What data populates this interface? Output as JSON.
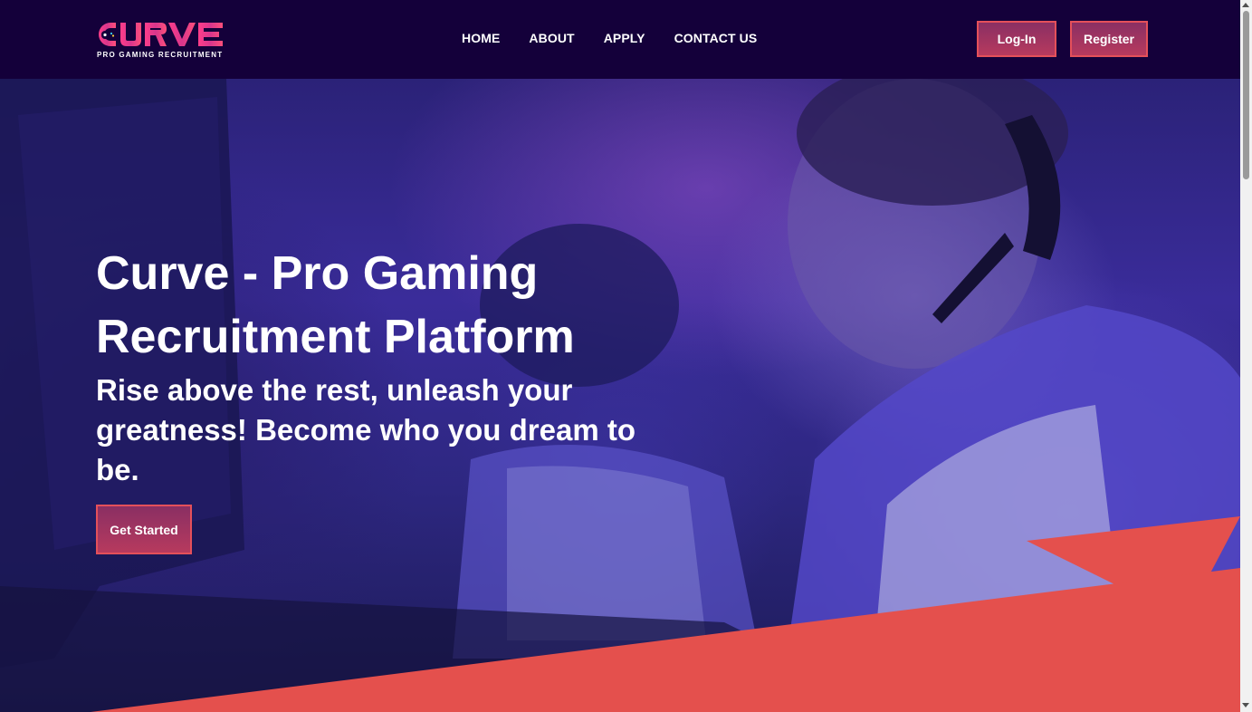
{
  "brand": {
    "logo_text": "CURVE",
    "tagline": "PRO GAMING RECRUITMENT"
  },
  "nav": {
    "items": [
      "HOME",
      "ABOUT",
      "APPLY",
      "CONTACT US"
    ]
  },
  "auth": {
    "login_label": "Log-In",
    "register_label": "Register"
  },
  "hero": {
    "title": "Curve - Pro Gaming Recruitment Platform",
    "subtitle": "Rise above the rest, unleash your greatness! Become who you dream to be.",
    "cta_label": "Get Started"
  },
  "colors": {
    "header_bg": "#14003a",
    "accent": "#e4505a",
    "button_gradient_top": "#8a2f63",
    "button_gradient_bottom": "#b73a5e"
  }
}
